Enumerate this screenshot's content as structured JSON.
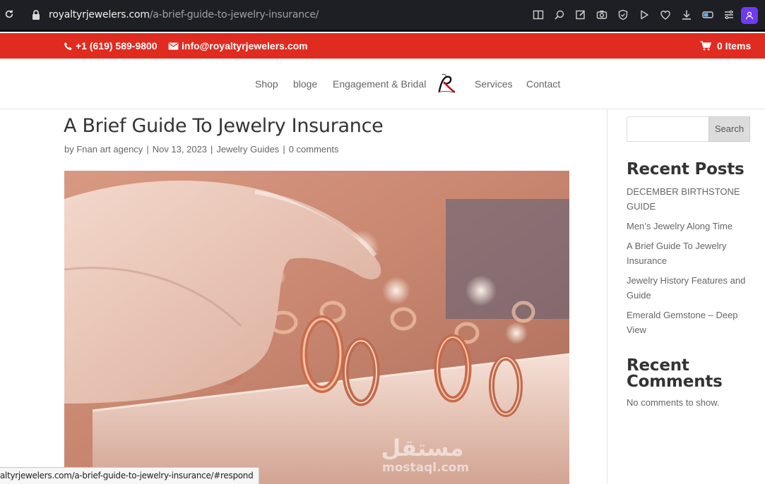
{
  "browser": {
    "url_host": "royaltyrjewelers.com",
    "url_path": "/a-brief-guide-to-jewelry-insurance/",
    "status_url": "altyrjewelers.com/a-brief-guide-to-jewelry-insurance/#respond"
  },
  "topbar": {
    "phone": "+1 (619) 589-9800",
    "email": "info@royaltyrjewelers.com",
    "cart": "0 Items",
    "background": "#e02b20"
  },
  "nav": {
    "items": [
      "Shop",
      "bloge",
      "Engagement & Bridal",
      "Services",
      "Contact"
    ]
  },
  "post": {
    "title": "A Brief Guide To Jewelry Insurance",
    "author_prefix": "by",
    "author": "Fnan art agency",
    "date": "Nov 13, 2023",
    "category": "Jewelry Guides",
    "comments": "0 comments",
    "watermark_text": "mostaql.com",
    "watermark_arabic": "مستقل"
  },
  "sidebar": {
    "search_button": "Search",
    "search_placeholder": "",
    "recent_posts_title": "Recent Posts",
    "recent_posts": [
      "DECEMBER BIRTHSTONE GUIDE",
      "Men’s Jewelry Along Time",
      "A Brief Guide To Jewelry Insurance",
      "Jewelry History Features and Guide",
      "Emerald Gemstone – Deep View"
    ],
    "recent_comments_title": "Recent Comments",
    "no_comments": "No comments to show."
  }
}
